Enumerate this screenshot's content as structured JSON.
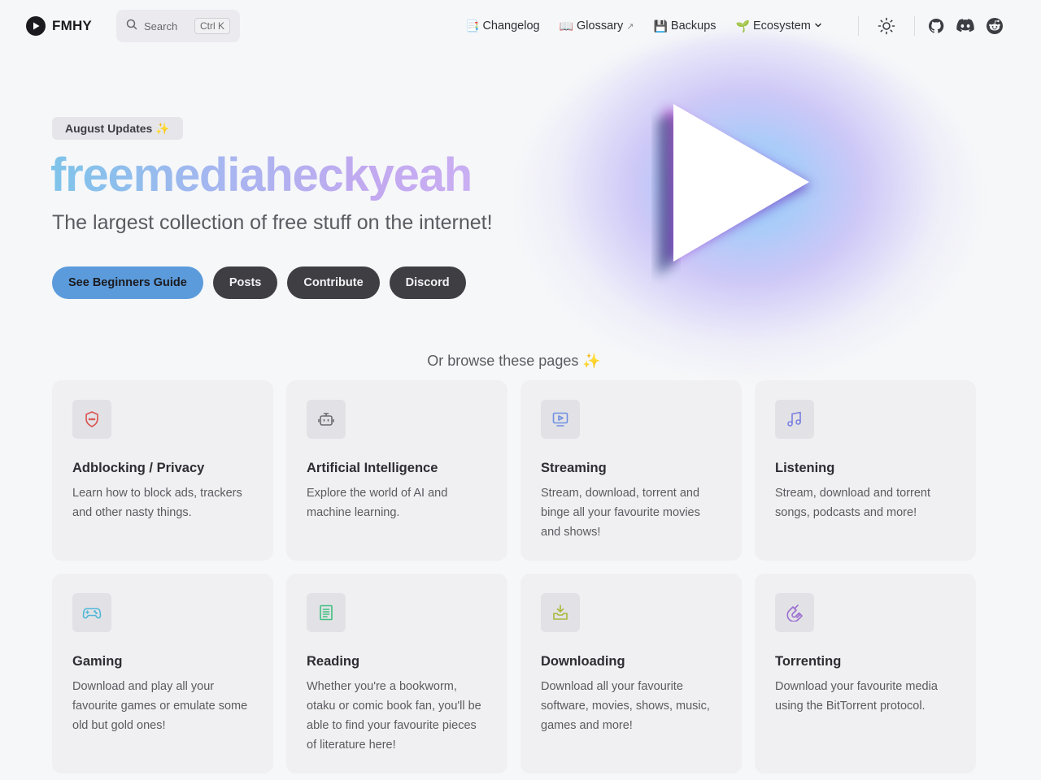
{
  "nav": {
    "brand": "FMHY",
    "search": {
      "placeholder": "Search",
      "shortcut": "Ctrl K"
    },
    "links": [
      {
        "emoji": "📑",
        "label": "Changelog"
      },
      {
        "emoji": "📖",
        "label": "Glossary",
        "external": "↗"
      },
      {
        "emoji": "💾",
        "label": "Backups"
      },
      {
        "emoji": "🌱",
        "label": "Ecosystem"
      }
    ]
  },
  "hero": {
    "badge": "August Updates ✨",
    "title": "freemediaheckyeah",
    "tagline": "The largest collection of free stuff on the internet!",
    "actions": {
      "primary": "See Beginners Guide",
      "posts": "Posts",
      "contribute": "Contribute",
      "discord": "Discord"
    }
  },
  "browse_heading": "Or browse these pages ✨",
  "cards": [
    {
      "title": "Adblocking / Privacy",
      "desc": "Learn how to block ads, trackers and other nasty things.",
      "icon": "shield-icon",
      "color": "#d9534f"
    },
    {
      "title": "Artificial Intelligence",
      "desc": "Explore the world of AI and machine learning.",
      "icon": "robot-icon",
      "color": "#6b6b70"
    },
    {
      "title": "Streaming",
      "desc": "Stream, download, torrent and binge all your favourite movies and shows!",
      "icon": "tv-play-icon",
      "color": "#6f8fe0"
    },
    {
      "title": "Listening",
      "desc": "Stream, download and torrent songs, podcasts and more!",
      "icon": "music-note-icon",
      "color": "#7b7fe0"
    },
    {
      "title": "Gaming",
      "desc": "Download and play all your favourite games or emulate some old but gold ones!",
      "icon": "gamepad-icon",
      "color": "#4fb8d8"
    },
    {
      "title": "Reading",
      "desc": "Whether you're a bookworm, otaku or comic book fan, you'll be able to find your favourite pieces of literature here!",
      "icon": "book-icon",
      "color": "#3fbf7f"
    },
    {
      "title": "Downloading",
      "desc": "Download all your favourite software, movies, shows, music, games and more!",
      "icon": "download-tray-icon",
      "color": "#a9b83a"
    },
    {
      "title": "Torrenting",
      "desc": "Download your favourite media using the BitTorrent protocol.",
      "icon": "magnet-icon",
      "color": "#9b6fd0"
    }
  ]
}
